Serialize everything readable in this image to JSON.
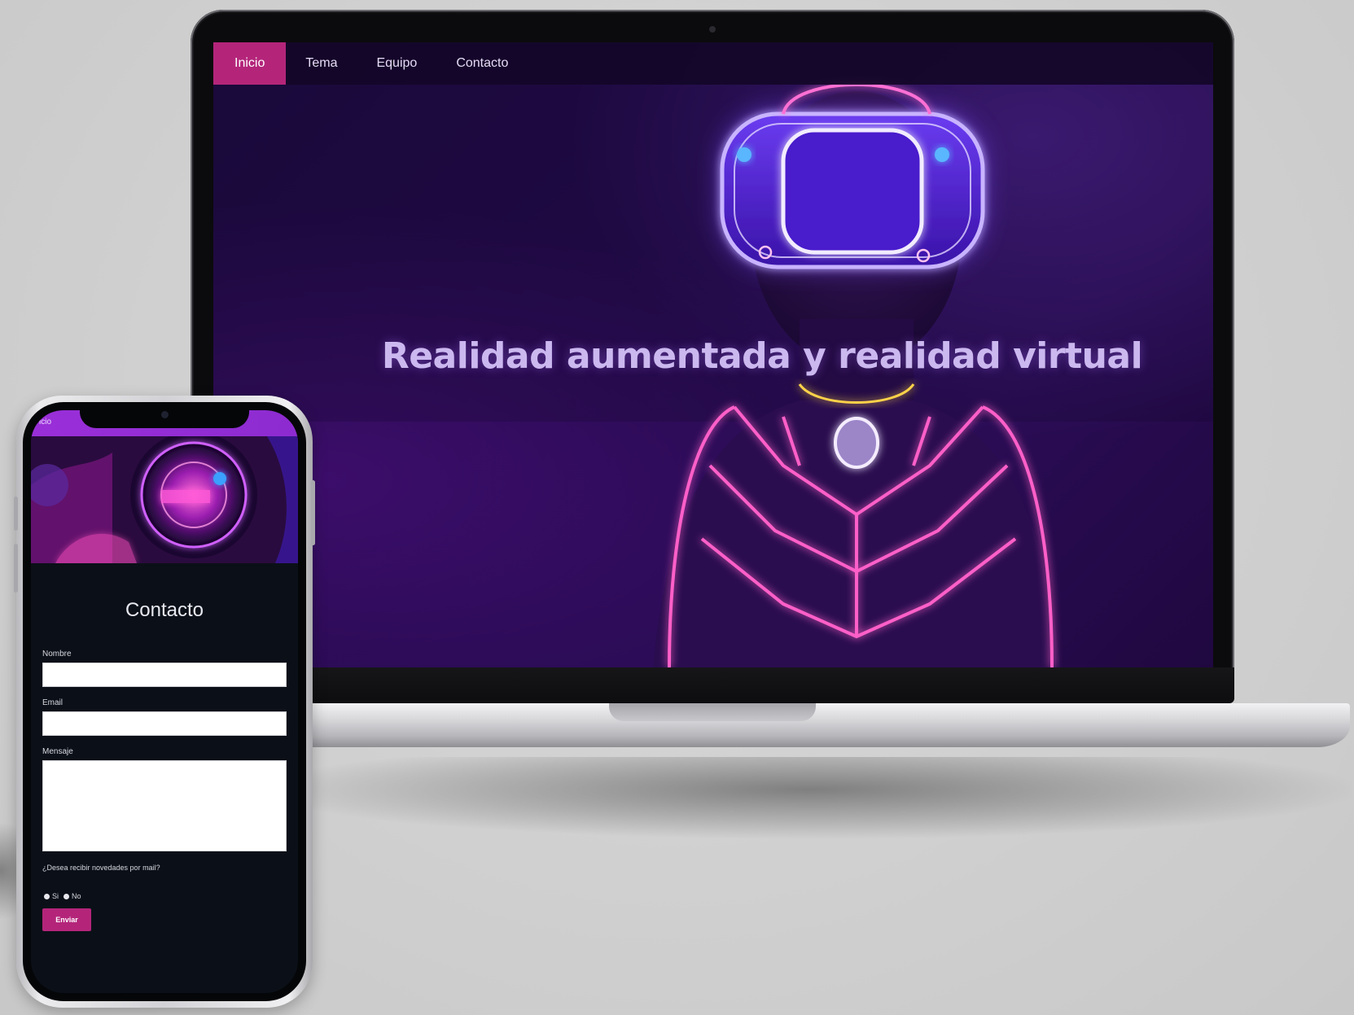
{
  "desktop_site": {
    "nav": {
      "items": [
        {
          "label": "Inicio",
          "active": true
        },
        {
          "label": "Tema",
          "active": false
        },
        {
          "label": "Equipo",
          "active": false
        },
        {
          "label": "Contacto",
          "active": false
        }
      ]
    },
    "hero_title": "Realidad aumentada y realidad virtual",
    "hero_image": "woman-with-vr-headset-neon-illustration"
  },
  "mobile_site": {
    "nav": {
      "visible_item": "icio"
    },
    "hero_image": "neon-vr-lens-closeup",
    "contact": {
      "title": "Contacto",
      "name_label": "Nombre",
      "name_value": "",
      "email_label": "Email",
      "email_value": "",
      "message_label": "Mensaje",
      "message_value": "",
      "newsletter_question": "¿Desea recibir novedades por mail?",
      "option_yes": "Si",
      "option_no": "No",
      "submit_label": "Enviar"
    }
  },
  "colors": {
    "accent_magenta": "#b4257a",
    "mobile_nav_purple": "#9a2fd9",
    "hero_bg": "#230a4b",
    "hero_title": "#cbb8ef",
    "mobile_bg": "#0b1018"
  }
}
